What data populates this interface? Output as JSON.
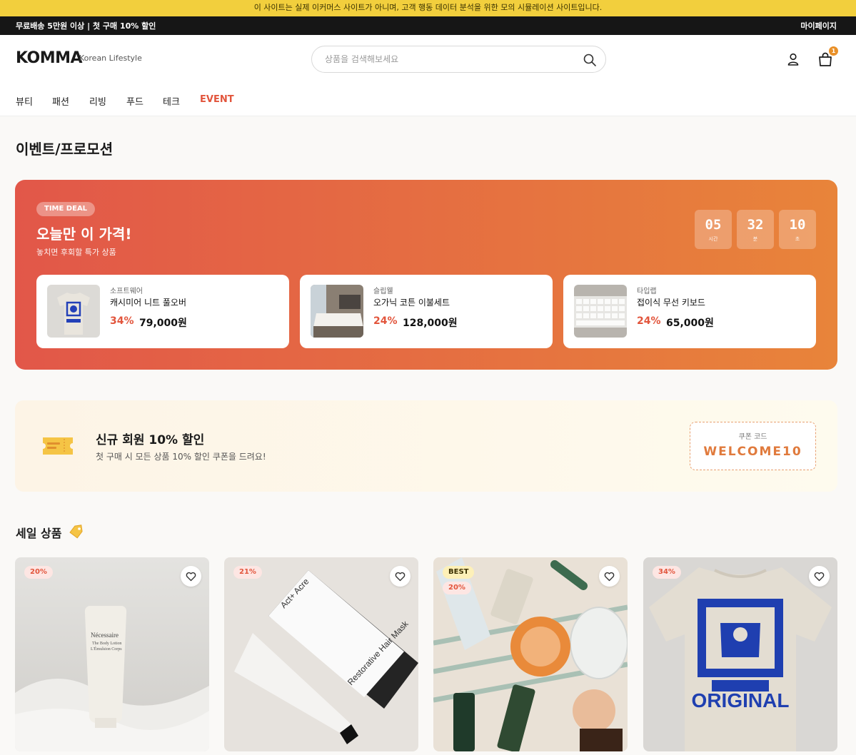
{
  "notice": "이 사이트는 실제 이커머스 사이트가 아니며, 고객 행동 데이터 분석을 위한 모의 시뮬레이션 사이트입니다.",
  "topbar": {
    "promo": "무료배송 5만원 이상 | 첫 구매 10% 할인",
    "mypage": "마이페이지"
  },
  "header": {
    "logo": "KOMMA",
    "logo_sub": "Korean Lifestyle",
    "search_placeholder": "상품을 검색해보세요",
    "cart_count": "1"
  },
  "nav": [
    "뷰티",
    "패션",
    "리빙",
    "푸드",
    "테크",
    "EVENT"
  ],
  "page_title": "이벤트/프로모션",
  "time_deal": {
    "badge": "TIME DEAL",
    "title": "오늘만 이 가격!",
    "subtitle": "놓치면 후회할 특가 상품",
    "timer": [
      {
        "value": "05",
        "unit": "시간"
      },
      {
        "value": "32",
        "unit": "분"
      },
      {
        "value": "10",
        "unit": "초"
      }
    ],
    "products": [
      {
        "brand": "소프트웨어",
        "name": "캐시미어 니트 풀오버",
        "discount": "34%",
        "price": "79,000원"
      },
      {
        "brand": "슬립웰",
        "name": "오가닉 코튼 이불세트",
        "discount": "24%",
        "price": "128,000원"
      },
      {
        "brand": "타입랩",
        "name": "접이식 무선 키보드",
        "discount": "24%",
        "price": "65,000원"
      }
    ]
  },
  "coupon": {
    "title": "신규 회원 10% 할인",
    "desc": "첫 구매 시 모든 상품 10% 할인 쿠폰을 드려요!",
    "code_label": "쿠폰 코드",
    "code": "WELCOME10"
  },
  "sale": {
    "title": "세일 상품",
    "products": [
      {
        "discount": "20%"
      },
      {
        "discount": "21%"
      },
      {
        "badge": "BEST",
        "discount": "20%"
      },
      {
        "discount": "34%"
      }
    ]
  },
  "colors": {
    "accent": "#e2553c",
    "notice_bg": "#f2cf3d",
    "deal_start": "#e25749",
    "deal_end": "#e8843a",
    "coupon_code": "#e07a3c"
  }
}
